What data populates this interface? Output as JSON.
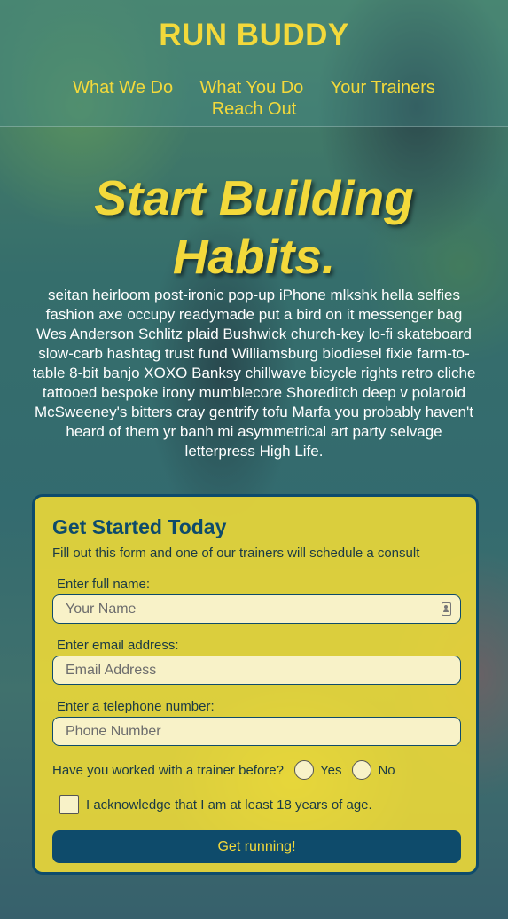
{
  "header": {
    "brand": "RUN BUDDY",
    "nav": [
      "What We Do",
      "What You Do",
      "Your Trainers",
      "Reach Out"
    ]
  },
  "hero": {
    "title_line1": "Start Building",
    "title_line2": "Habits.",
    "text": "seitan heirloom post-ironic pop-up iPhone mlkshk hella selfies fashion axe occupy readymade put a bird on it messenger bag Wes Anderson Schlitz plaid Bushwick church-key lo-fi skateboard slow-carb hashtag trust fund Williamsburg biodiesel fixie farm-to-table 8-bit banjo XOXO Banksy chillwave bicycle rights retro cliche tattooed bespoke irony mumblecore Shoreditch deep v polaroid McSweeney's bitters cray gentrify tofu Marfa you probably haven't heard of them yr banh mi asymmetrical art party selvage letterpress High Life."
  },
  "form": {
    "title": "Get Started Today",
    "subtitle": "Fill out this form and one of our trainers will schedule a consult",
    "name_label": "Enter full name:",
    "name_placeholder": "Your Name",
    "email_label": "Enter email address:",
    "email_placeholder": "Email Address",
    "phone_label": "Enter a telephone number:",
    "phone_placeholder": "Phone Number",
    "trainer_question": "Have you worked with a trainer before?",
    "yes_label": "Yes",
    "no_label": "No",
    "ack_label": "I acknowledge that I am at least 18 years of age.",
    "submit_label": "Get running!"
  },
  "colors": {
    "accent": "#f3d93b",
    "primary": "#0e4b6b",
    "form_bg": "#f1dc37"
  }
}
